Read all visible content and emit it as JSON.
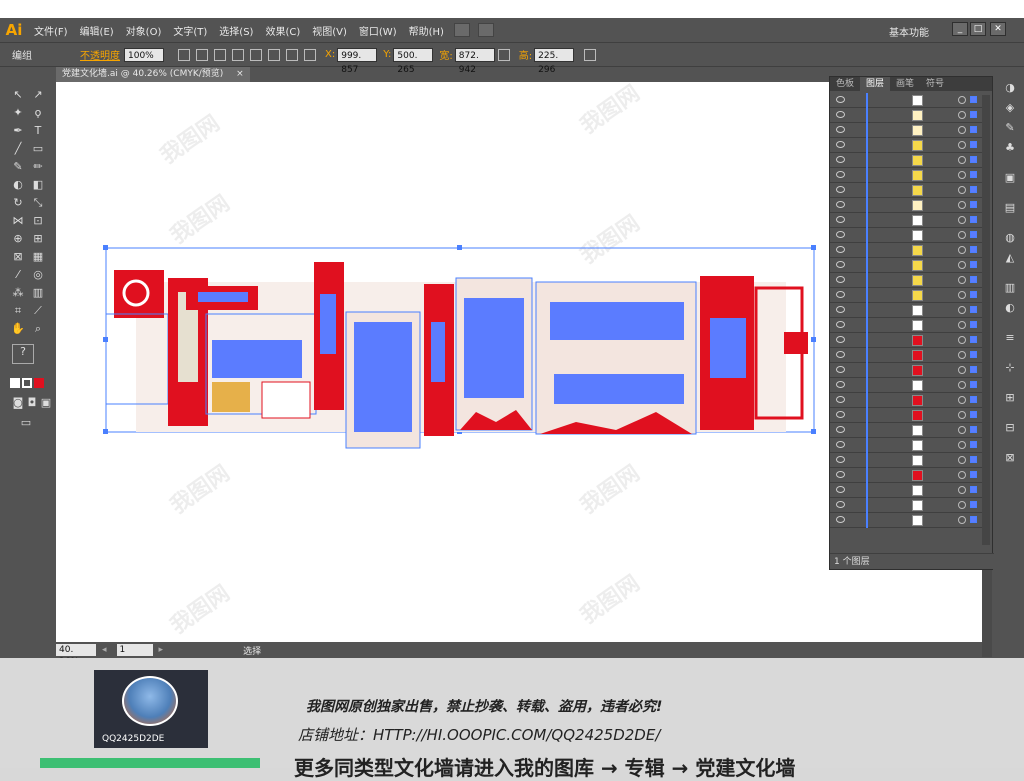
{
  "menubar": {
    "logo": "Ai",
    "items": [
      "文件(F)",
      "编辑(E)",
      "对象(O)",
      "文字(T)",
      "选择(S)",
      "效果(C)",
      "视图(V)",
      "窗口(W)",
      "帮助(H)"
    ],
    "workspace": "基本功能"
  },
  "controlbar": {
    "mode": "编组",
    "opacity_label": "不透明度",
    "opacity_value": "100%",
    "x_label": "X:",
    "x_value": "999. 857",
    "y_label": "Y:",
    "y_value": "500. 265",
    "w_label": "宽:",
    "w_value": "872. 942",
    "h_label": "高:",
    "h_value": "225. 296"
  },
  "document": {
    "tab_title": "党建文化墙.ai @ 40.26% (CMYK/预览)",
    "close": "×"
  },
  "statusbar": {
    "zoom": "40. 26%",
    "page": "1",
    "status": "选择"
  },
  "layers_panel": {
    "tabs": [
      "色板",
      "图层",
      "画笔",
      "符号"
    ],
    "active_tab": "图层",
    "footer": "1 个图层"
  },
  "promo": {
    "avatar_name": "QQ2425D2DE",
    "line1": "我图网原创独家出售，禁止抄袭、转载、盗用，违者必究!",
    "line2": "店铺地址：HTTP://HI.OOOPIC.COM/QQ2425D2DE/",
    "line3": "更多同类型文化墙请进入我的图库 → 专辑 → 党建文化墙"
  },
  "watermark": "我图网",
  "colors": {
    "accent": "#f7a500",
    "party_red": "#e0101f",
    "selection_blue": "#4a80ff",
    "ui_gray": "#535353"
  }
}
